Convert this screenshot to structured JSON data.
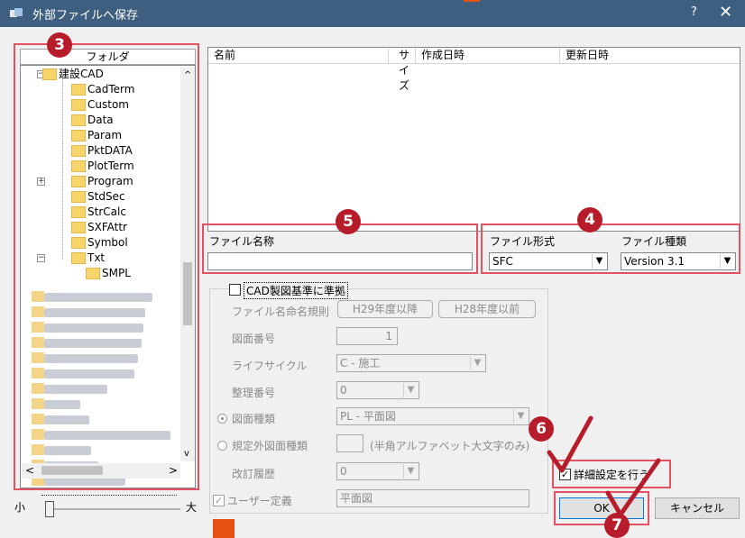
{
  "window": {
    "title": "外部ファイルへ保存",
    "help_label": "?",
    "close_label": "✕"
  },
  "folder_panel": {
    "header": "フォルダ",
    "tree": [
      {
        "label": "建設CAD",
        "indent": 0,
        "expander": "⊟"
      },
      {
        "label": "CadTerm",
        "indent": 1
      },
      {
        "label": "Custom",
        "indent": 1
      },
      {
        "label": "Data",
        "indent": 1
      },
      {
        "label": "Param",
        "indent": 1
      },
      {
        "label": "PktDATA",
        "indent": 1
      },
      {
        "label": "PlotTerm",
        "indent": 1
      },
      {
        "label": "Program",
        "indent": 1,
        "expander": "⊞"
      },
      {
        "label": "StdSec",
        "indent": 1
      },
      {
        "label": "StrCalc",
        "indent": 1
      },
      {
        "label": "SXFAttr",
        "indent": 1
      },
      {
        "label": "Symbol",
        "indent": 1
      },
      {
        "label": "Txt",
        "indent": 1,
        "expander": "⊟"
      },
      {
        "label": "SMPL",
        "indent": 2
      }
    ],
    "blurred_rows": 14,
    "hscroll_left": "<",
    "hscroll_right": ">",
    "vscroll_up": "^",
    "vscroll_down": "v"
  },
  "zoom": {
    "small_label": "小",
    "large_label": "大"
  },
  "file_list": {
    "columns": [
      "名前",
      "サイズ",
      "作成日時",
      "更新日時"
    ]
  },
  "file_name": {
    "label": "ファイル名称",
    "value": ""
  },
  "file_format": {
    "label": "ファイル形式",
    "value": "SFC"
  },
  "file_type": {
    "label": "ファイル種類",
    "value": "Version 3.1"
  },
  "cad_standard": {
    "checkbox_label": "CAD製図基準に準拠",
    "naming_rule_label": "ファイル名命名規則",
    "naming_rule_btn_after": "H29年度以降",
    "naming_rule_btn_before": "H28年度以前",
    "drawing_number_label": "図面番号",
    "drawing_number_value": "1",
    "lifecycle_label": "ライフサイクル",
    "lifecycle_value": "C - 施工",
    "reference_number_label": "整理番号",
    "reference_number_value": "0",
    "drawing_type_label": "図面種類",
    "drawing_type_value": "PL - 平面図",
    "nonstandard_type_label": "規定外図面種類",
    "nonstandard_type_hint": "(半角アルファベット大文字のみ)",
    "revision_label": "改訂履歴",
    "revision_value": "0",
    "user_defined_label": "ユーザー定義",
    "user_defined_value": "平面図"
  },
  "detail_settings": {
    "label": "詳細設定を行う",
    "checked": true
  },
  "buttons": {
    "ok": "OK",
    "cancel": "キャンセル"
  },
  "annotations": {
    "b3": "3",
    "b4": "4",
    "b5": "5",
    "b6": "6",
    "b7": "7"
  },
  "colors": {
    "annotation_red": "#b71c2b",
    "highlight_border": "#e35262",
    "titlebar": "#3f5f81"
  }
}
